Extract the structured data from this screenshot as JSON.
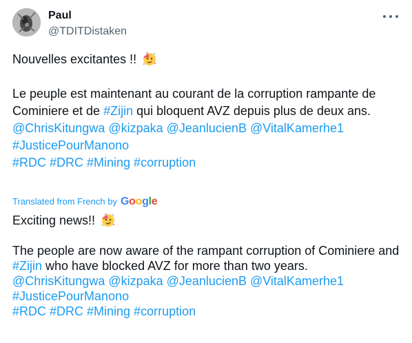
{
  "author": {
    "name": "Paul",
    "handle": "@TDITDistaken"
  },
  "menu": {
    "icon": "more-horizontal-icon"
  },
  "original": {
    "line1": "Nouvelles excitantes !!",
    "para2": "Le peuple est maintenant au courant de la corruption rampante de Cominiere et de ",
    "para2_tag": "#Zijin",
    "para2_end": " qui bloquent AVZ depuis plus de deux ans.",
    "mentions": "@ChrisKitungwa @kizpaka @JeanlucienB @VitalKamerhe1",
    "tag_justice": "#JusticePourManono",
    "tags_final": "#RDC #DRC #Mining #corruption"
  },
  "translation": {
    "label": "Translated from French by",
    "provider_letters": [
      "G",
      "o",
      "o",
      "g",
      "l",
      "e"
    ],
    "line1": "Exciting news!!",
    "para2": "The people are now aware of the rampant corruption of Cominiere and ",
    "para2_tag": "#Zijin",
    "para2_end": " who have blocked AVZ for more than two years.",
    "mentions": "@ChrisKitungwa @kizpaka @JeanlucienB @VitalKamerhe1",
    "tag_justice": "#JusticePourManono",
    "tags_final": "#RDC #DRC #Mining #corruption"
  },
  "emoji": "party-face-icon",
  "colors": {
    "link": "#1d9bf0",
    "text": "#0f1419",
    "muted": "#536471"
  }
}
